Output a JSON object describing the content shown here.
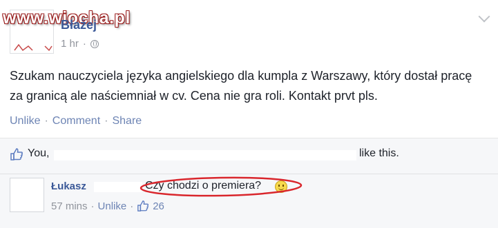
{
  "watermark": "www.wiocha.pl",
  "post": {
    "author": "Błażej",
    "time": "1 hr",
    "separator": "·",
    "text": "Szukam nauczyciela języka angielskiego dla kumpla z Warszawy, który dostał pracę za granicą ale naściemniał w cv. Cena nie gra roli. Kontakt prvt pls.",
    "actions": {
      "unlike": "Unlike",
      "comment": "Comment",
      "share": "Share",
      "sep": "·"
    }
  },
  "likes": {
    "you": "You,",
    "suffix": "like this."
  },
  "comment": {
    "author": "Łukasz",
    "text": "Czy chodzi o premiera?",
    "time": "57 mins",
    "unlike": "Unlike",
    "sep": "·",
    "like_count": "26"
  },
  "colors": {
    "link": "#3b5998",
    "annotation": "#d9262c"
  }
}
